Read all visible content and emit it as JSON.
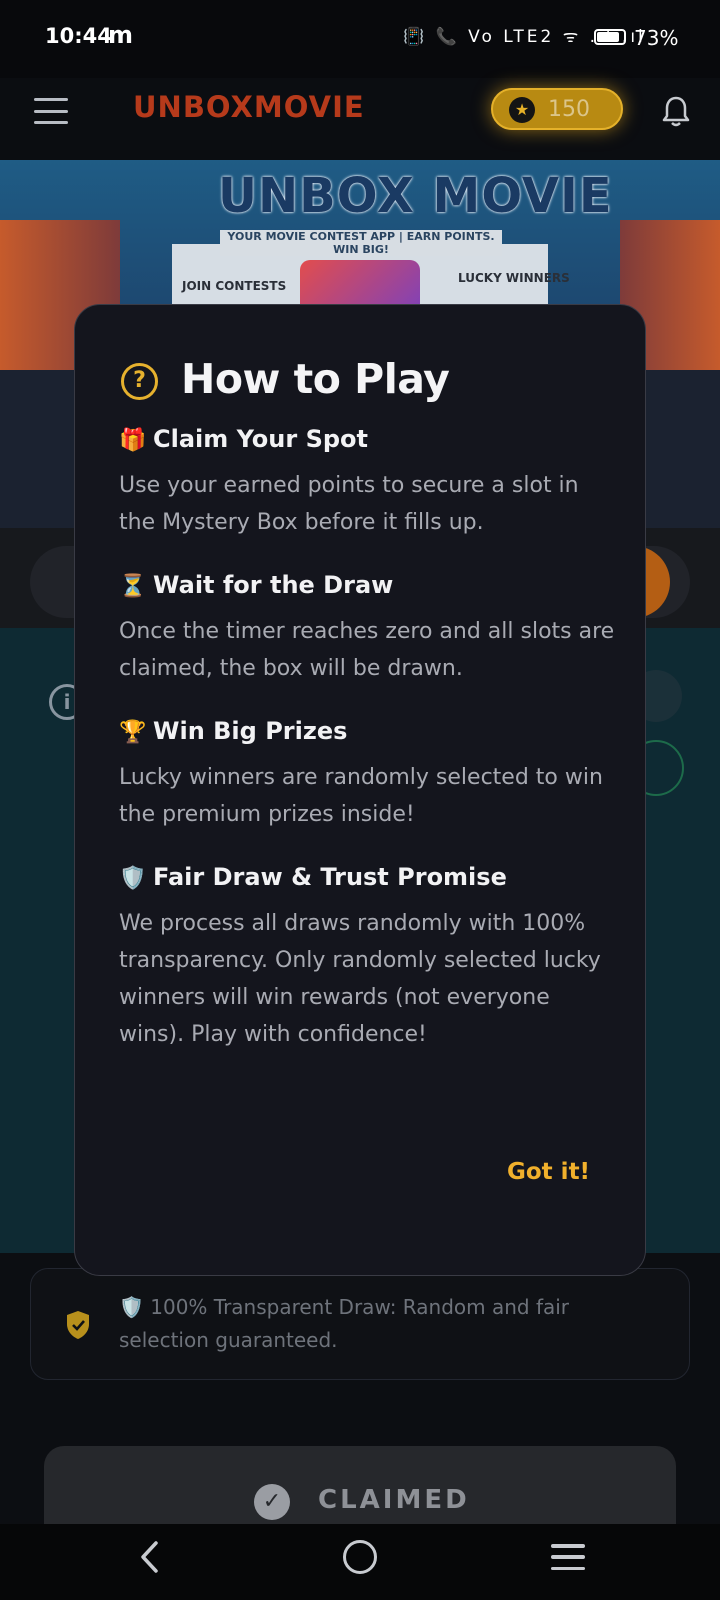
{
  "status_bar": {
    "time": "10:44",
    "carrier_glyph": "m",
    "signal_icons": "📳 📞 Vo LTE2 ᯤ .ıl .ıl",
    "battery": "73%"
  },
  "header": {
    "app_title": "UNBOXMOVIE",
    "points": "150",
    "icons": [
      "menu-icon",
      "star-icon",
      "bell-icon"
    ]
  },
  "banner": {
    "title": "UNBOX MOVIE",
    "subtitle": "YOUR MOVIE CONTEST APP | EARN POINTS. WIN BIG!",
    "join_label": "JOIN CONTESTS",
    "lucky_label": "LUCKY WINNERS"
  },
  "modal": {
    "title": "How to Play",
    "sections": [
      {
        "emoji": "🎁",
        "heading": "Claim Your Spot",
        "body": "Use your earned points to secure a slot in the Mystery Box before it fills up."
      },
      {
        "emoji": "⏳",
        "heading": "Wait for the Draw",
        "body": "Once the timer reaches zero and all slots are claimed, the box will be drawn."
      },
      {
        "emoji": "🏆",
        "heading": "Win Big Prizes",
        "body": "Lucky winners are randomly selected to win the premium prizes inside!"
      },
      {
        "emoji": "🛡️",
        "heading": "Fair Draw & Trust Promise",
        "body": "We process all draws randomly with 100% transparency. Only randomly selected lucky winners will win rewards (not everyone wins). Play with confidence!"
      }
    ],
    "confirm_label": "Got it!"
  },
  "trust_notice": {
    "text": "🛡️ 100% Transparent Draw: Random and fair selection guaranteed."
  },
  "claim_button": {
    "label": "CLAIMED"
  },
  "colors": {
    "accent": "#f1b02c",
    "modal_bg": "#14151d",
    "brand_red": "#b63a1b"
  }
}
